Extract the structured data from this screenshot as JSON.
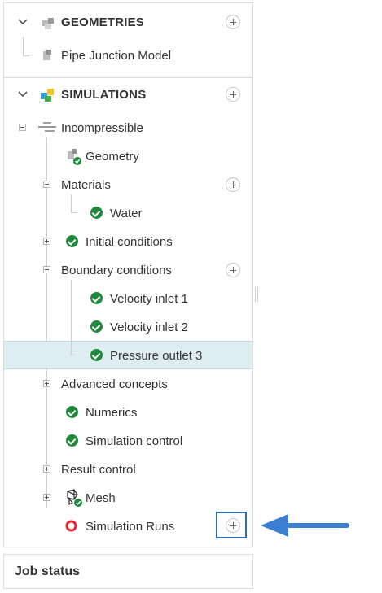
{
  "tree": {
    "geometries": {
      "label": "GEOMETRIES",
      "items": [
        "Pipe Junction Model"
      ]
    },
    "simulations": {
      "label": "SIMULATIONS",
      "simulation": {
        "label": "Incompressible",
        "geometry": "Geometry",
        "materials": {
          "label": "Materials",
          "items": [
            "Water"
          ]
        },
        "initial_conditions": "Initial conditions",
        "boundary_conditions": {
          "label": "Boundary conditions",
          "items": [
            "Velocity inlet 1",
            "Velocity inlet 2",
            "Pressure outlet 3"
          ]
        },
        "advanced_concepts": "Advanced concepts",
        "numerics": "Numerics",
        "simulation_control": "Simulation control",
        "result_control": "Result control",
        "mesh": "Mesh",
        "simulation_runs": "Simulation Runs"
      }
    },
    "selected_item": "Pressure outlet 3"
  },
  "job_status": {
    "label": "Job status"
  },
  "colors": {
    "check": "#1f8a3b",
    "selection": "#deedf2",
    "callout": "#2e6db6",
    "run_status": "#e0282e"
  }
}
